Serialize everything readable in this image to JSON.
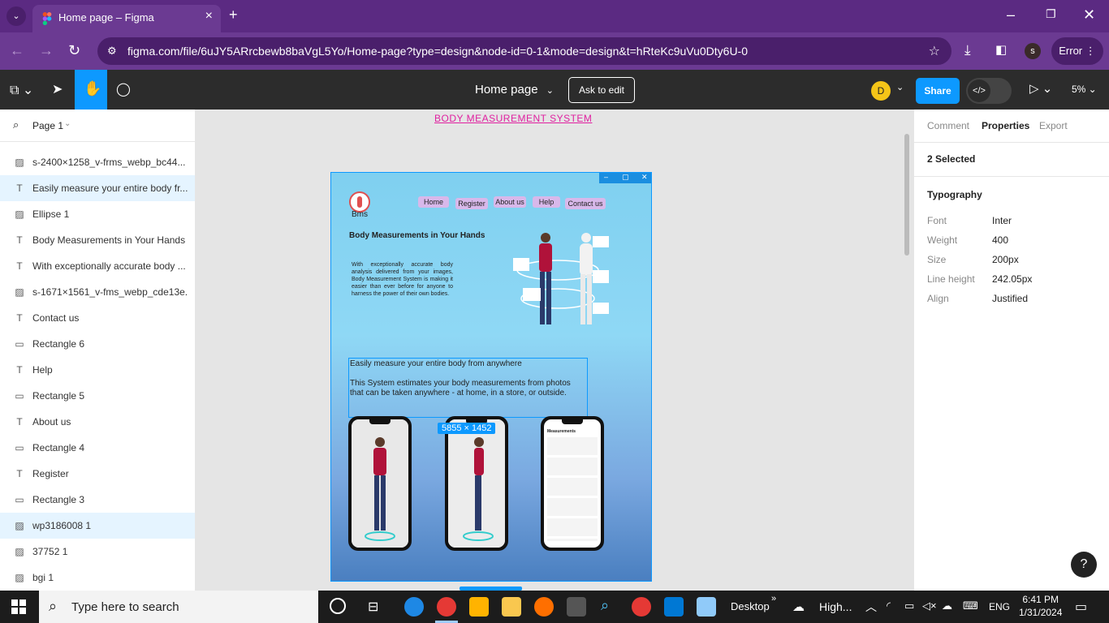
{
  "browser": {
    "tab_title": "Home page – Figma",
    "url": "figma.com/file/6uJY5ARrcbewb8baVgL5Yo/Home-page?type=design&node-id=0-1&mode=design&t=hRteKc9uVu0Dty6U-0",
    "profile_initial": "s",
    "error_label": "Error"
  },
  "figma": {
    "file_title": "Home page",
    "ask_to_edit": "Ask to edit",
    "avatar_initial": "D",
    "share": "Share",
    "zoom": "5%",
    "page_name": "Page 1"
  },
  "layers": [
    {
      "icon": "image",
      "name": "s-2400×1258_v-frms_webp_bc44...",
      "selected": false
    },
    {
      "icon": "text",
      "name": "Easily measure your entire body fr...",
      "selected": true
    },
    {
      "icon": "image",
      "name": "Ellipse 1",
      "selected": false
    },
    {
      "icon": "text",
      "name": "Body Measurements in Your Hands",
      "selected": false
    },
    {
      "icon": "text",
      "name": "With exceptionally accurate body ...",
      "selected": false
    },
    {
      "icon": "image",
      "name": "s-1671×1561_v-fms_webp_cde13e...",
      "selected": false
    },
    {
      "icon": "text",
      "name": "Contact us",
      "selected": false
    },
    {
      "icon": "rect",
      "name": "Rectangle 6",
      "selected": false
    },
    {
      "icon": "text",
      "name": "Help",
      "selected": false
    },
    {
      "icon": "rect",
      "name": "Rectangle 5",
      "selected": false
    },
    {
      "icon": "text",
      "name": "About us",
      "selected": false
    },
    {
      "icon": "rect",
      "name": "Rectangle 4",
      "selected": false
    },
    {
      "icon": "text",
      "name": "Register",
      "selected": false
    },
    {
      "icon": "rect",
      "name": "Rectangle 3",
      "selected": false
    },
    {
      "icon": "image",
      "name": "wp3186008 1",
      "selected": true
    },
    {
      "icon": "image",
      "name": "37752 1",
      "selected": false
    },
    {
      "icon": "image",
      "name": "bgi 1",
      "selected": false
    }
  ],
  "canvas": {
    "frame_heading": "BODY MEASUREMENT SYSTEM",
    "nav": [
      "Home",
      "Register",
      "About us",
      "Help",
      "Contact us"
    ],
    "logo_text": "Bms",
    "hero_title": "Body Measurements in Your Hands",
    "hero_paragraph": "With exceptionally accurate body analysis delivered from your images, Body Measurement System is making it easier than ever before for anyone to harness the power of their own bodies.",
    "selected_line1": "Easily measure your entire body from anywhere",
    "selected_line2a": "This System estimates your body measurements from  photos",
    "selected_line2b": "that can be taken anywhere - at home, in a store, or outside.",
    "dimension_badge": "5855 × 1452",
    "phone3_title": "Measurements"
  },
  "properties": {
    "tabs": [
      "Comment",
      "Properties",
      "Export"
    ],
    "selection": "2 Selected",
    "section": "Typography",
    "rows": [
      {
        "label": "Font",
        "value": "Inter"
      },
      {
        "label": "Weight",
        "value": "400"
      },
      {
        "label": "Size",
        "value": "200px"
      },
      {
        "label": "Line height",
        "value": "242.05px"
      },
      {
        "label": "Align",
        "value": "Justified"
      }
    ],
    "help": "?"
  },
  "taskbar": {
    "search_placeholder": "Type here to search",
    "desktop_label": "Desktop",
    "weather": "High...",
    "lang": "ENG",
    "time": "6:41 PM",
    "date": "1/31/2024"
  },
  "colors": {
    "chrome_purple": "#5b2a82",
    "figma_blue": "#0d99ff",
    "heading_pink": "#e020a0"
  }
}
